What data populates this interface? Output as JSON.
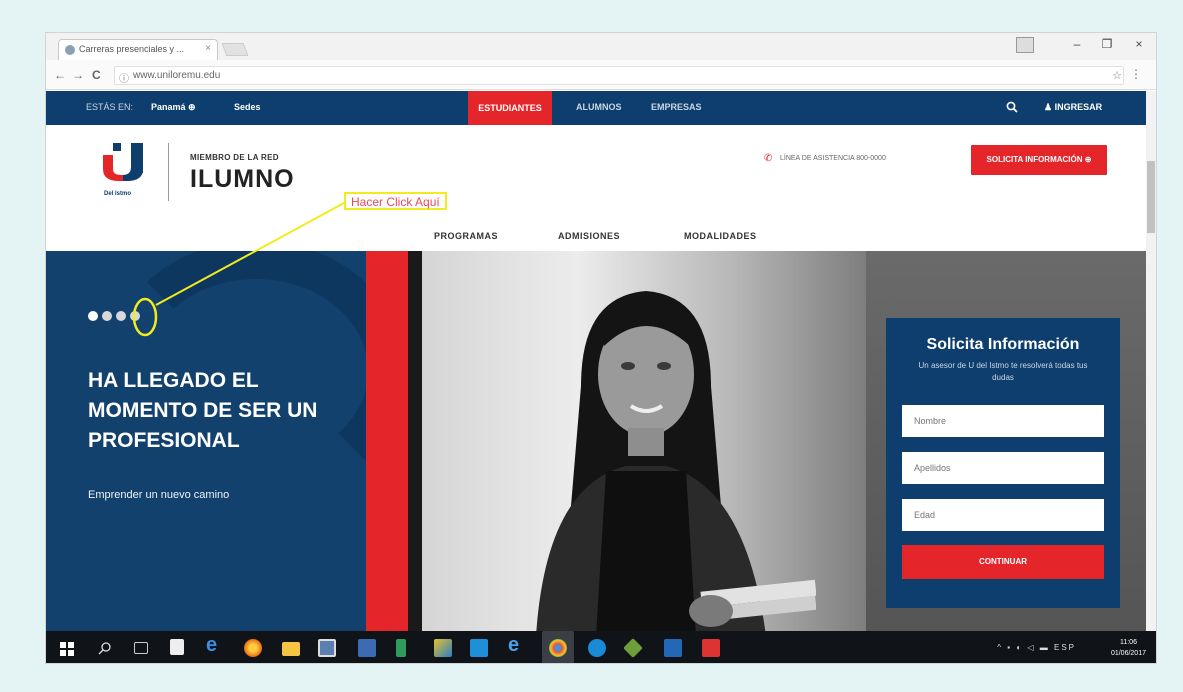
{
  "browser": {
    "tab_title": "Carreras presenciales y ...",
    "tab_close": "×",
    "url": "www.uniloremu.edu",
    "nav_back": "←",
    "nav_forward": "→",
    "nav_reload": "C",
    "minimize": "–",
    "maximize": "❐",
    "close": "×",
    "star": "☆",
    "menu": "⋮"
  },
  "topbar": {
    "estas_en": "ESTÁS EN:",
    "location": "Panamá ⊕",
    "sedes": "Sedes",
    "estudiantes": "ESTUDIANTES",
    "alumnos": "ALUMNOS",
    "empresas": "EMPRESAS",
    "search_icon": "search-icon",
    "ingresar": "INGRESAR"
  },
  "header": {
    "logo_sub": "Del Istmo",
    "member": "MIEMBRO DE LA RED",
    "ilumno": "ILUMNO",
    "phone": "LÍNEA DE ASISTENCIA 800-0000",
    "solicita_btn": "SOLICITA INFORMACIÓN ⊕",
    "nav": [
      "PROGRAMAS",
      "ADMISIONES",
      "MODALIDADES"
    ]
  },
  "annotation": {
    "label": "Hacer Click Aquí"
  },
  "hero": {
    "slides": 4,
    "active_slide": 1,
    "title": "HA LLEGADO EL MOMENTO DE SER UN PROFESIONAL",
    "subtitle": "Emprender un nuevo camino"
  },
  "form": {
    "title": "Solicita Información",
    "desc": "Un asesor de U del Istmo te resolverá todas tus dudas",
    "nombre_placeholder": "Nombre",
    "apellidos_placeholder": "Apellidos",
    "edad_placeholder": "Edad",
    "submit": "CONTINUAR"
  },
  "taskbar": {
    "tray_text": "ESP",
    "time": "11:06",
    "date": "01/06/2017"
  },
  "colors": {
    "brand_blue": "#0d3e6e",
    "brand_red": "#e4262b",
    "annotation_yellow": "#f2ec1f"
  }
}
